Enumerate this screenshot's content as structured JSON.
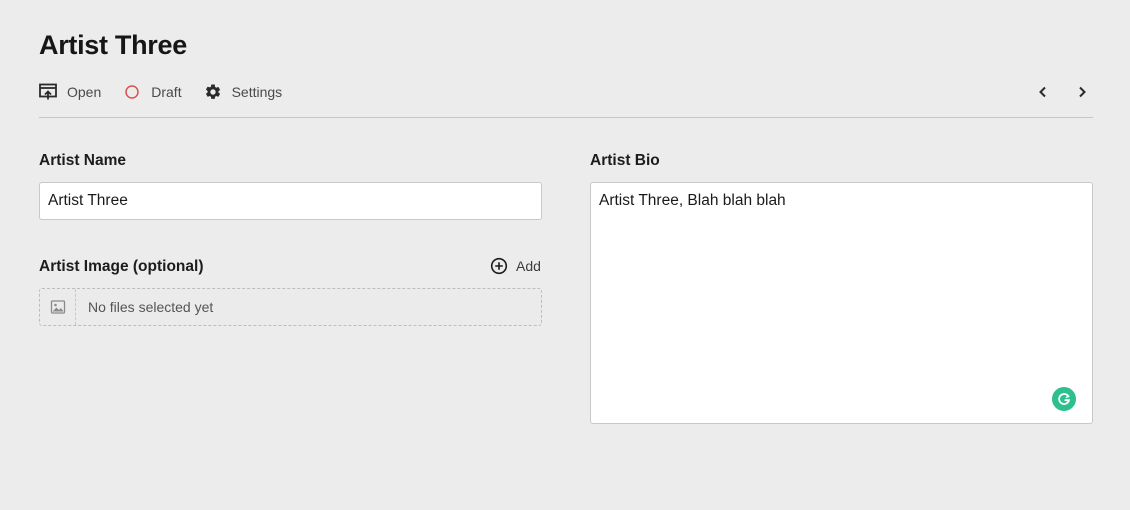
{
  "page": {
    "title": "Artist Three"
  },
  "toolbar": {
    "open_label": "Open",
    "draft_label": "Draft",
    "settings_label": "Settings",
    "draft_status_color": "#d9534f"
  },
  "form": {
    "name": {
      "label": "Artist Name",
      "value": "Artist Three"
    },
    "image": {
      "label": "Artist Image (optional)",
      "add_label": "Add",
      "empty_text": "No files selected yet"
    },
    "bio": {
      "label": "Artist Bio",
      "value": "Artist Three, Blah blah blah"
    }
  },
  "icons": {
    "open": "open-in-preview-icon",
    "draft": "circle-status-icon",
    "settings": "gear-icon",
    "prev": "chevron-left-icon",
    "next": "chevron-right-icon",
    "add": "plus-circle-icon",
    "image": "image-icon",
    "assistant": "grammarly-icon"
  },
  "colors": {
    "background": "#ececec",
    "assistant": "#2dbf8e"
  }
}
